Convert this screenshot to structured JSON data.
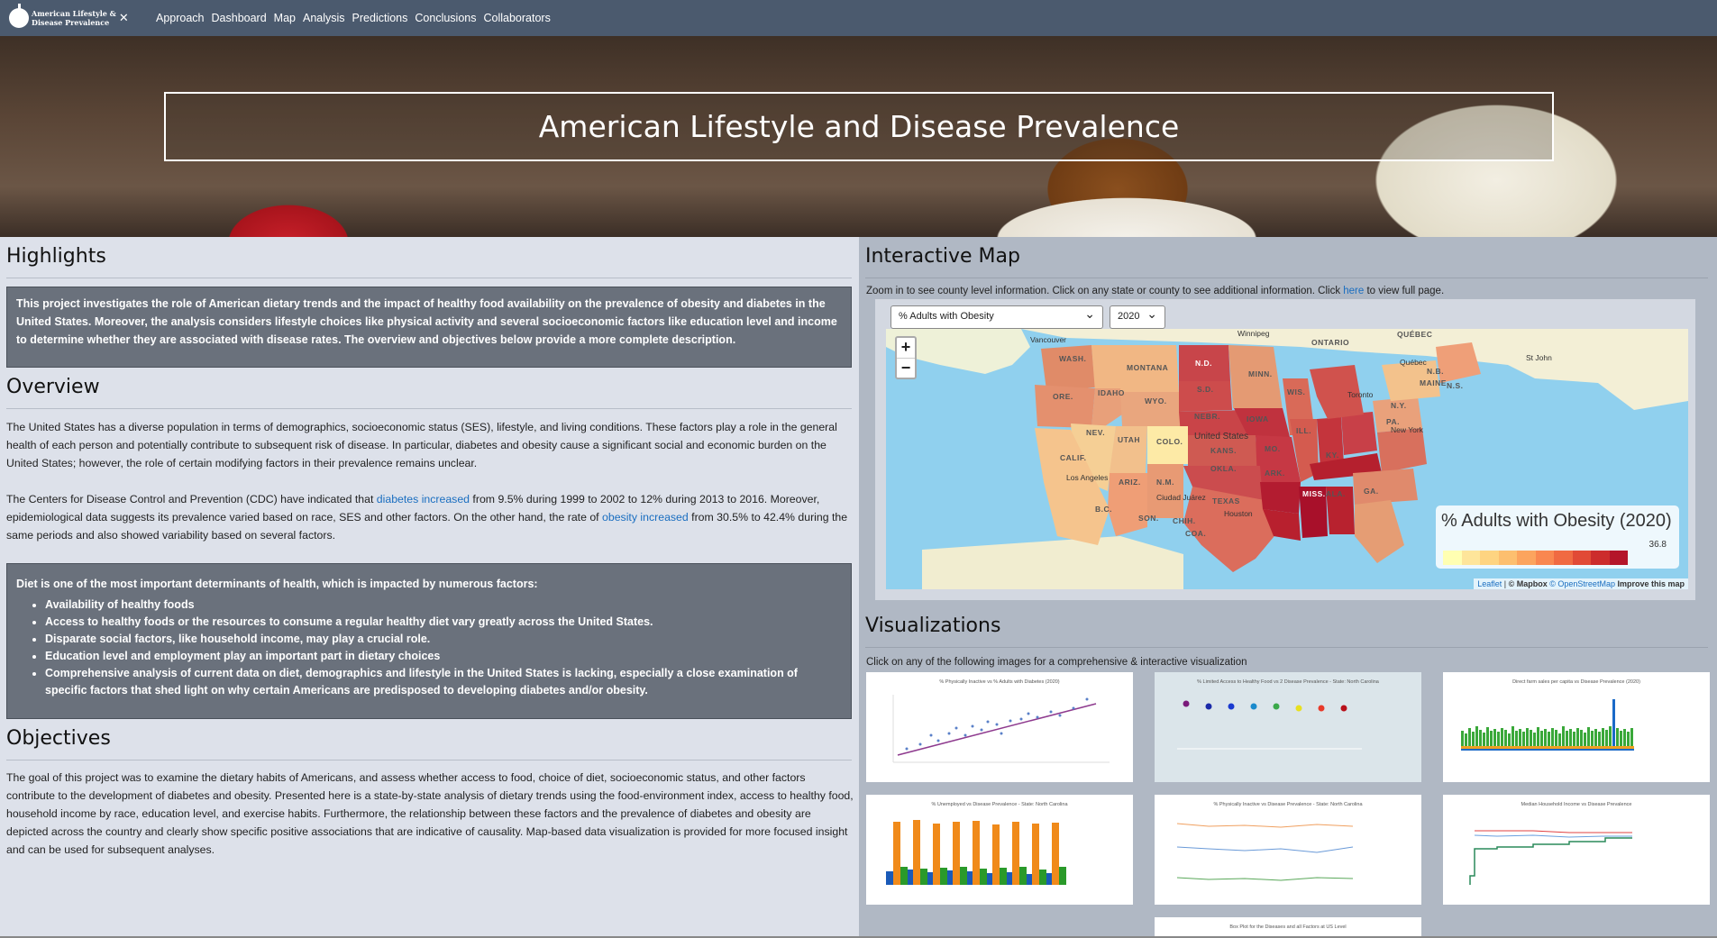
{
  "brand": {
    "line1": "American Lifestyle &",
    "line2": "Disease Prevalence"
  },
  "nav": [
    "Approach",
    "Dashboard",
    "Map",
    "Analysis",
    "Predictions",
    "Conclusions",
    "Collaborators"
  ],
  "hero": {
    "title": "American Lifestyle and Disease Prevalence"
  },
  "highlights": {
    "title": "Highlights",
    "text": "This project investigates the role of American dietary trends and the impact of healthy food availability on the prevalence of obesity and diabetes in the United States. Moreover, the analysis considers lifestyle choices like physical activity and several socioeconomic factors like education level and income to determine whether they are associated with disease rates. The overview and objectives below provide a more complete description."
  },
  "overview": {
    "title": "Overview",
    "p1": "The United States has a diverse population in terms of demographics, socioeconomic status (SES), lifestyle, and living conditions. These factors play a role in the general health of each person and potentially contribute to subsequent risk of disease. In particular, diabetes and obesity cause a significant social and economic burden on the United States; however, the role of certain modifying factors in their prevalence remains unclear.",
    "p2_a": "The Centers for Disease Control and Prevention (CDC) have indicated that ",
    "p2_link1": "diabetes increased",
    "p2_b": " from 9.5% during 1999 to 2002 to 12% during 2013 to 2016. Moreover, epidemiological data suggests its prevalence varied based on race, SES and other factors. On the other hand, the rate of ",
    "p2_link2": "obesity increased",
    "p2_c": " from 30.5% to 42.4% during the same periods and also showed variability based on several factors."
  },
  "diet": {
    "heading": "Diet is one of the most important determinants of health, which is impacted by numerous factors:",
    "items": [
      "Availability of healthy foods",
      "Access to healthy foods or the resources to consume a regular healthy diet vary greatly across the United States.",
      "Disparate social factors, like household income, may play a crucial role.",
      "Education level and employment play an important part in dietary choices",
      "Comprehensive analysis of current data on diet, demographics and lifestyle in the United States is lacking, especially a close examination of specific factors that shed light on why certain Americans are predisposed to developing diabetes and/or obesity."
    ]
  },
  "objectives": {
    "title": "Objectives",
    "text": "The goal of this project was to examine the dietary habits of Americans, and assess whether access to food, choice of diet, socioeconomic status, and other factors contribute to the development of diabetes and obesity. Presented here is a state-by-state analysis of dietary trends using the food-environment index, access to healthy food, household income by race, education level, and exercise habits. Furthermore, the relationship between these factors and the prevalence of diabetes and obesity are depicted across the country and clearly show specific positive associations that are indicative of causality. Map-based data visualization is provided for more focused insight and can be used for subsequent analyses."
  },
  "map": {
    "title": "Interactive Map",
    "instructions_a": "Zoom in to see county level information. Click on any state or county to see additional information. Click ",
    "instructions_link": "here",
    "instructions_b": " to view full page.",
    "metric_select": "% Adults with Obesity",
    "year_select": "2020",
    "zoom_in": "+",
    "zoom_out": "−",
    "legend_title": "% Adults with Obesity (2020)",
    "legend_max": "36.8",
    "legend_colors": [
      "#ffffb2",
      "#fee59a",
      "#fed481",
      "#fdbf6f",
      "#fca45e",
      "#f98750",
      "#f06a42",
      "#e14a36",
      "#cc2c2c",
      "#b4152a"
    ],
    "attribution_leaflet": "Leaflet",
    "attribution_mapbox": "© Mapbox",
    "attribution_osm": "© OpenStreetMap",
    "attribution_improve": "Improve this map",
    "labels": [
      "WASH.",
      "MONTANA",
      "N.D.",
      "MINN.",
      "ORE.",
      "IDAHO",
      "WYO.",
      "S.D.",
      "WIS.",
      "NEBR.",
      "IOWA",
      "NEV.",
      "UTAH",
      "COLO.",
      "KANS.",
      "MO.",
      "ILL.",
      "CALIF.",
      "ARIZ.",
      "N.M.",
      "OKLA.",
      "ARK.",
      "TEXAS",
      "MISS.",
      "ALA.",
      "KY.",
      "PA.",
      "SON.",
      "CHIH.",
      "COA.",
      "B.C.",
      "ONTARIO",
      "QUÉBEC",
      "N.B.",
      "N.S.",
      "MAINE",
      "N.Y.",
      "GA."
    ],
    "cities": [
      "Vancouver",
      "Winnipeg",
      "Québec",
      "Toronto",
      "New York",
      "United States",
      "Los Angeles",
      "Houston",
      "Ciudad Juárez",
      "St John"
    ]
  },
  "visualizations": {
    "title": "Visualizations",
    "subtitle": "Click on any of the following images for a comprehensive & interactive visualization",
    "thumbs": [
      "% Physically Inactive vs % Adults with Diabetes (2020)",
      "% Limited Access to Healthy Food vs 2 Disease Prevalence - State: North Carolina",
      "Direct farm sales per capita vs Disease Prevalence (2020)",
      "% Unemployed vs Disease Prevalence - State: North Carolina",
      "% Physically Inactive vs Disease Prevalence - State: North Carolina",
      "Median Household Income vs Disease Prevalence",
      "Box Plot for the Diseases and all Factors at US Level"
    ]
  }
}
